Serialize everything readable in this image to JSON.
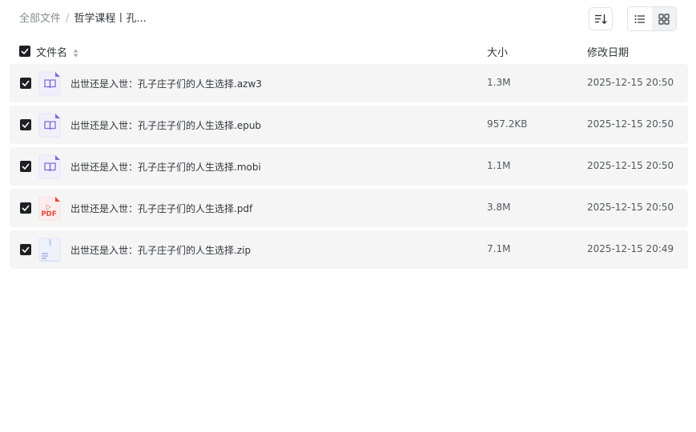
{
  "breadcrumb": {
    "root": "全部文件",
    "separator": "/",
    "current": "哲学课程丨孔..."
  },
  "toolbar": {
    "sort_icon": "sort-lines-icon",
    "list_view_icon": "list-view-icon",
    "grid_view_icon": "grid-view-icon",
    "active_view": "list"
  },
  "table": {
    "headers": {
      "name": "文件名",
      "size": "大小",
      "date": "修改日期"
    },
    "rows": [
      {
        "name": "出世还是入世：孔子庄子们的人生选择.azw3",
        "size": "1.3M",
        "date": "2025-12-15 20:50",
        "icon": "ebook-icon",
        "checked": true
      },
      {
        "name": "出世还是入世：孔子庄子们的人生选择.epub",
        "size": "957.2KB",
        "date": "2025-12-15 20:50",
        "icon": "ebook-icon",
        "checked": true
      },
      {
        "name": "出世还是入世：孔子庄子们的人生选择.mobi",
        "size": "1.1M",
        "date": "2025-12-15 20:50",
        "icon": "ebook-icon",
        "checked": true
      },
      {
        "name": "出世还是入世：孔子庄子们的人生选择.pdf",
        "size": "3.8M",
        "date": "2025-12-15 20:50",
        "icon": "pdf-icon",
        "icon_text": "PDF",
        "checked": true
      },
      {
        "name": "出世还是入世：孔子庄子们的人生选择.zip",
        "size": "7.1M",
        "date": "2025-12-15 20:49",
        "icon": "zip-icon",
        "checked": true
      }
    ]
  },
  "colors": {
    "row_bg": "#f5f5f6",
    "checkbox": "#1f2024",
    "ebook_accent": "#7b6fd6",
    "pdf_accent": "#e5473f",
    "zip_accent": "#8fa2d6"
  }
}
